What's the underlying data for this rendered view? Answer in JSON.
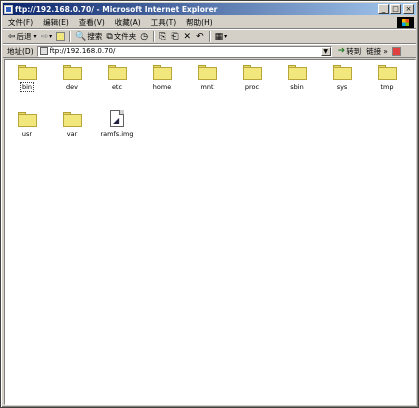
{
  "window": {
    "title": "ftp://192.168.0.70/ - Microsoft Internet Explorer",
    "minimize": "_",
    "maximize": "□",
    "close": "×"
  },
  "menu": [
    "文件(F)",
    "编辑(E)",
    "查看(V)",
    "收藏(A)",
    "工具(T)",
    "帮助(H)"
  ],
  "toolbar": {
    "back": "后退",
    "search": "搜索",
    "folders": "文件夹"
  },
  "address": {
    "label": "地址(D)",
    "value": "ftp://192.168.0.70/",
    "go": "转到",
    "links": "链接",
    "more": "»"
  },
  "items": [
    {
      "name": "bin",
      "type": "folder",
      "selected": true
    },
    {
      "name": "dev",
      "type": "folder"
    },
    {
      "name": "etc",
      "type": "folder"
    },
    {
      "name": "home",
      "type": "folder"
    },
    {
      "name": "mnt",
      "type": "folder"
    },
    {
      "name": "proc",
      "type": "folder"
    },
    {
      "name": "sbin",
      "type": "folder"
    },
    {
      "name": "sys",
      "type": "folder"
    },
    {
      "name": "tmp",
      "type": "folder"
    },
    {
      "name": "usr",
      "type": "folder"
    },
    {
      "name": "var",
      "type": "folder"
    },
    {
      "name": "ramfs.img",
      "type": "file"
    }
  ]
}
